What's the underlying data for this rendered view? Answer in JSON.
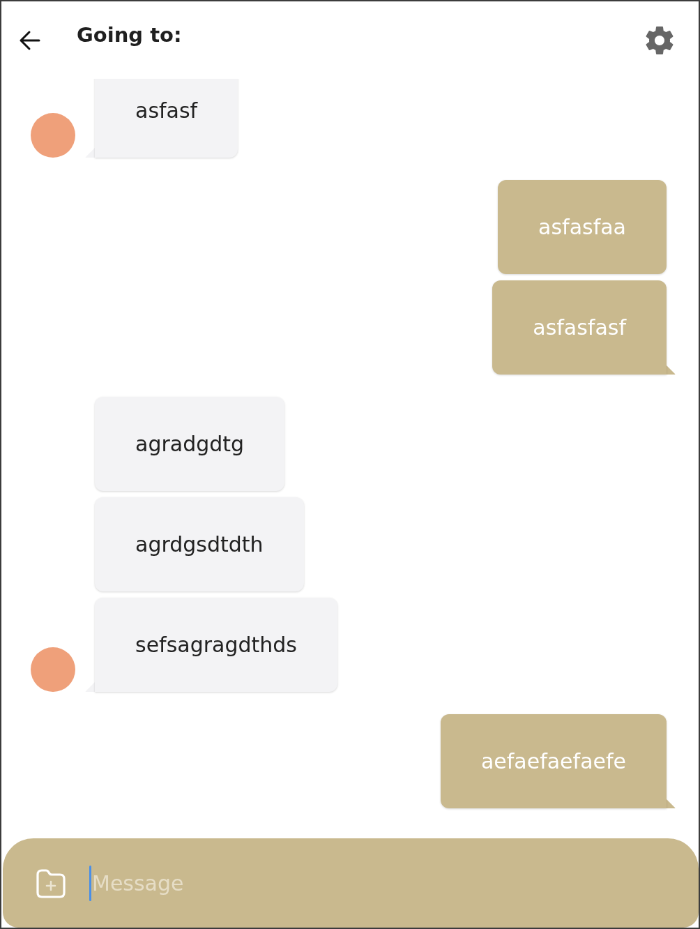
{
  "header": {
    "title": "Going to:"
  },
  "groups": [
    {
      "kind": "incoming",
      "messages": [
        "asfasf"
      ]
    },
    {
      "kind": "outgoing",
      "messages": [
        "asfasfaa",
        "asfasfasf"
      ]
    },
    {
      "kind": "incoming",
      "messages": [
        "agradgdtg",
        "agrdgsdtdth",
        "sefsagragdthds"
      ]
    },
    {
      "kind": "outgoing",
      "messages": [
        "aefaefaefaefe"
      ]
    }
  ],
  "input": {
    "placeholder": "Message",
    "focused": true
  }
}
